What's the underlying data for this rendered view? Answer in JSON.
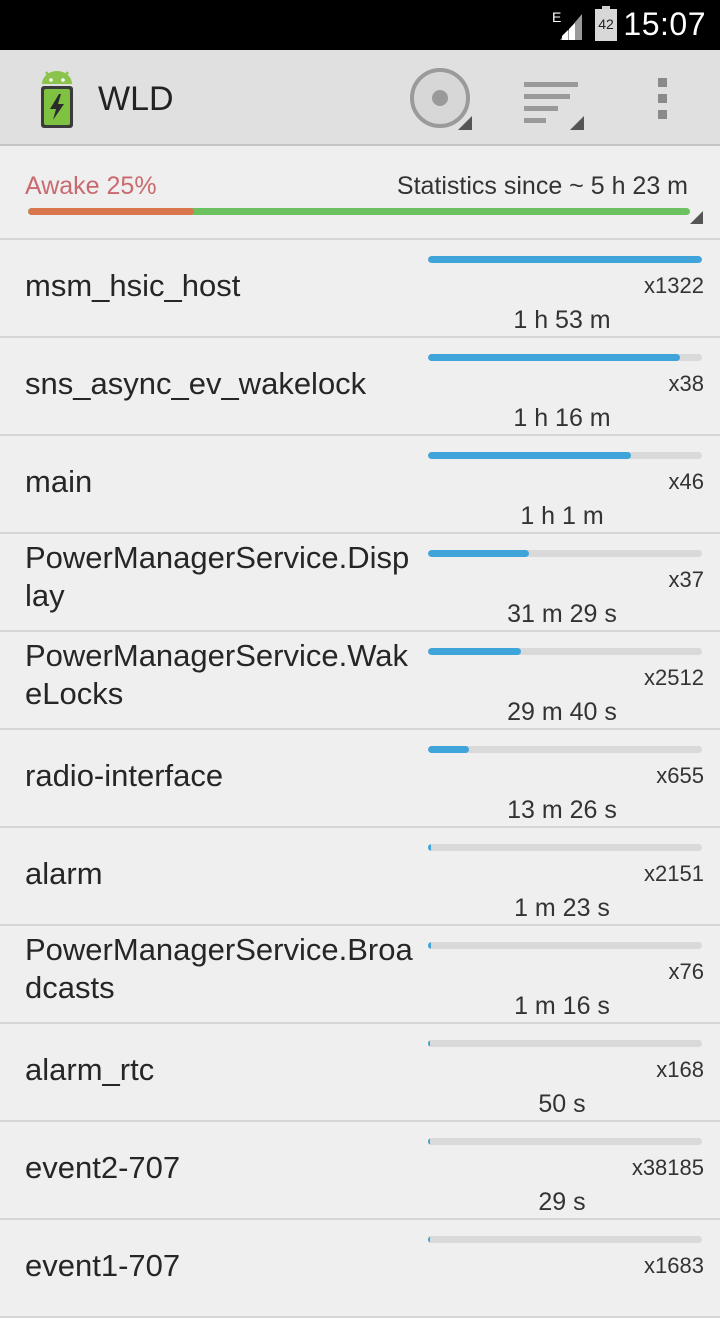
{
  "status_bar": {
    "time": "15:07",
    "network_type": "E",
    "battery_level": "42",
    "icons": [
      "signal-icon",
      "battery-icon"
    ]
  },
  "action_bar": {
    "title": "WLD",
    "icons": [
      "app-battery-icon",
      "record-icon",
      "sort-icon",
      "overflow-menu-icon"
    ]
  },
  "summary": {
    "awake_label": "Awake 25%",
    "stats_since": "Statistics since ~ 5 h 23 m",
    "awake_fraction": 0.25,
    "colors": {
      "awake": "#d9764e",
      "asleep": "#6cc160",
      "awake_text": "#c86a70"
    }
  },
  "wakelocks": [
    {
      "name": "msm_hsic_host",
      "count": "x1322",
      "duration": "1 h 53 m",
      "fraction": 1.0
    },
    {
      "name": "sns_async_ev_wakelock",
      "count": "x38",
      "duration": "1 h 16 m",
      "fraction": 0.92
    },
    {
      "name": "main",
      "count": "x46",
      "duration": "1 h 1 m",
      "fraction": 0.74
    },
    {
      "name": "PowerManagerService.Display",
      "count": "x37",
      "duration": "31 m 29 s",
      "fraction": 0.37
    },
    {
      "name": "PowerManagerService.WakeLocks",
      "count": "x2512",
      "duration": "29 m 40 s",
      "fraction": 0.34
    },
    {
      "name": "radio-interface",
      "count": "x655",
      "duration": "13 m 26 s",
      "fraction": 0.15
    },
    {
      "name": "alarm",
      "count": "x2151",
      "duration": "1 m 23 s",
      "fraction": 0.01
    },
    {
      "name": "PowerManagerService.Broadcasts",
      "count": "x76",
      "duration": "1 m 16 s",
      "fraction": 0.01
    },
    {
      "name": "alarm_rtc",
      "count": "x168",
      "duration": "50 s",
      "fraction": 0.005
    },
    {
      "name": "event2-707",
      "count": "x38185",
      "duration": "29 s",
      "fraction": 0.004
    },
    {
      "name": "event1-707",
      "count": "x1683",
      "duration": "",
      "fraction": 0.003
    }
  ],
  "colors": {
    "bar_fill": "#3fa4d9",
    "bar_track": "#d9d9d9"
  }
}
